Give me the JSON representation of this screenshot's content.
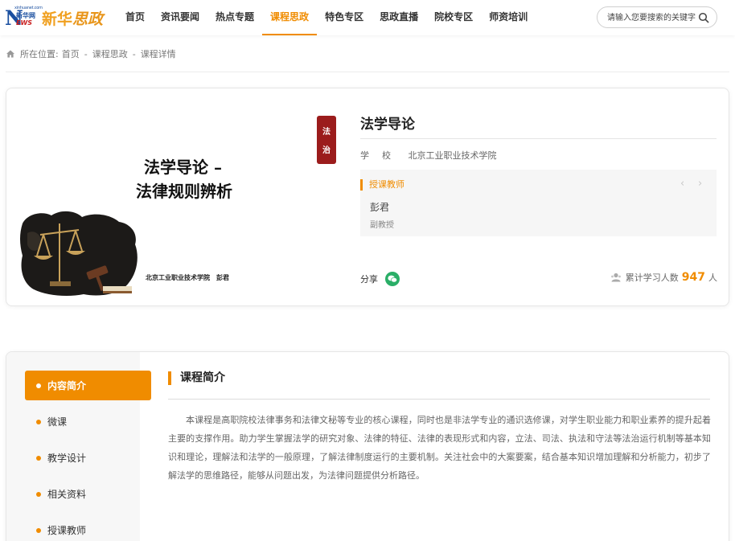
{
  "header": {
    "logo": {
      "news_tiny": "xinhuanet.com",
      "news_cn": "新华网",
      "news_letters": "EWS",
      "brand": "新华",
      "brand_accent": "思政"
    },
    "nav": [
      {
        "label": "首页",
        "active": false
      },
      {
        "label": "资讯要闻",
        "active": false
      },
      {
        "label": "热点专题",
        "active": false
      },
      {
        "label": "课程思政",
        "active": true
      },
      {
        "label": "特色专区",
        "active": false
      },
      {
        "label": "思政直播",
        "active": false
      },
      {
        "label": "院校专区",
        "active": false
      },
      {
        "label": "师资培训",
        "active": false
      }
    ],
    "search": {
      "placeholder": "请输入您要搜索的关键字",
      "icon": "search-icon"
    }
  },
  "breadcrumb": {
    "label": "所在位置:",
    "items": [
      "首页",
      "课程思政",
      "课程详情"
    ],
    "separator": "-"
  },
  "course": {
    "cover": {
      "seal_chars": [
        "法",
        "治"
      ],
      "title_line1": "法学导论 –",
      "title_line2": "法律规则辨析",
      "caption": "北京工业职业技术学院　彭君"
    },
    "title": "法学导论",
    "school_label": "学校",
    "school": "北京工业职业技术学院",
    "teacher_heading": "授课教师",
    "teacher": {
      "name": "彭君",
      "rank": "副教授"
    },
    "share_label": "分享",
    "learners_label": "累计学习人数",
    "learners_count": "947",
    "learners_unit": "人"
  },
  "side_menu": [
    {
      "label": "内容简介",
      "active": true
    },
    {
      "label": "微课",
      "active": false
    },
    {
      "label": "教学设计",
      "active": false
    },
    {
      "label": "相关资料",
      "active": false
    },
    {
      "label": "授课教师",
      "active": false
    }
  ],
  "content": {
    "section_title": "课程简介",
    "text": "本课程是高职院校法律事务和法律文秘等专业的核心课程，同时也是非法学专业的通识选修课，对学生职业能力和职业素养的提升起着主要的支撑作用。助力学生掌握法学的研究对象、法律的特征、法律的表现形式和内容，立法、司法、执法和守法等法治运行机制等基本知识和理论，理解法和法学的一般原理，了解法律制度运行的主要机制。关注社会中的大案要案，结合基本知识增加理解和分析能力，初步了解法学的思维路径，能够从问题出发，为法律问题提供分析路径。"
  },
  "colors": {
    "accent": "#f08c00",
    "wechat": "#2aae67",
    "seal": "#9b1c1c",
    "logo_blue": "#1a4fa0"
  }
}
